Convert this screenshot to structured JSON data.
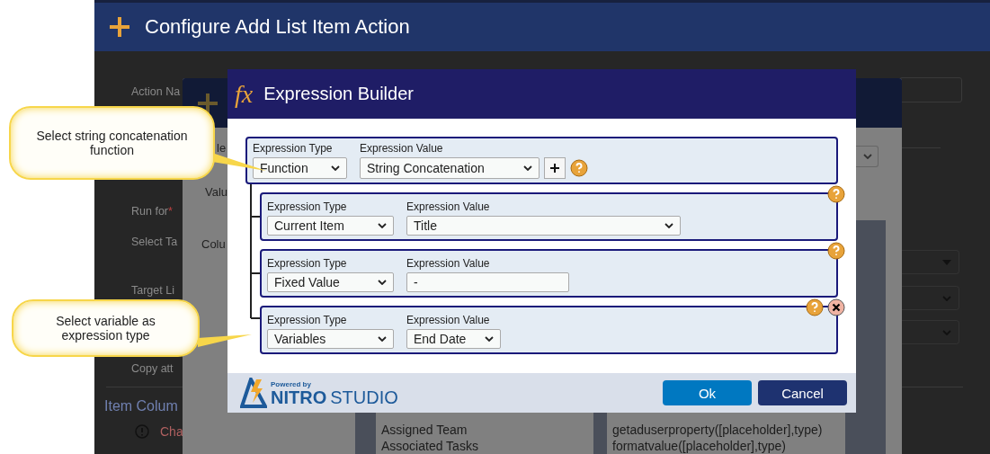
{
  "page_header": {
    "title": "Configure Add List Item Action"
  },
  "background_form": {
    "fields": [
      {
        "label": "Action Na"
      },
      {
        "label": "Run for",
        "marker": "*"
      },
      {
        "label": "Select Ta"
      },
      {
        "label": "Target Li"
      },
      {
        "label": "Copy att"
      }
    ],
    "section_title": "Item Colum",
    "notice": "Cha"
  },
  "background_dialog": {
    "labels": [
      "le",
      "Valu",
      "Colu"
    ],
    "list_items": [
      "Assigned Team",
      "Associated Tasks"
    ],
    "functions": [
      "getaduserproperty([placeholder],type)",
      "formatvalue([placeholder],type)"
    ]
  },
  "dialog": {
    "icon_text": "fx",
    "title": "Expression Builder",
    "root": {
      "type_label": "Expression Type",
      "value_label": "Expression Value",
      "type": "Function",
      "value": "String Concatenation"
    },
    "children": [
      {
        "kind": "select",
        "type_label": "Expression Type",
        "value_label": "Expression Value",
        "type": "Current Item",
        "value": "Title",
        "removable": false
      },
      {
        "kind": "text",
        "type_label": "Expression Type",
        "value_label": "Expression Value",
        "type": "Fixed Value",
        "value": "-",
        "removable": false
      },
      {
        "kind": "select",
        "type_label": "Expression Type",
        "value_label": "Expression Value",
        "type": "Variables",
        "value": "End Date",
        "removable": true
      }
    ],
    "logo": {
      "tagline": "Powered by",
      "brand": "NITRO",
      "product": "STUDIO"
    },
    "buttons": [
      {
        "label": "Ok",
        "kind": "primary"
      },
      {
        "label": "Cancel",
        "kind": "secondary"
      }
    ]
  },
  "callouts": [
    {
      "text": "Select string concatenation function"
    },
    {
      "text": "Select variable as expression type"
    }
  ]
}
